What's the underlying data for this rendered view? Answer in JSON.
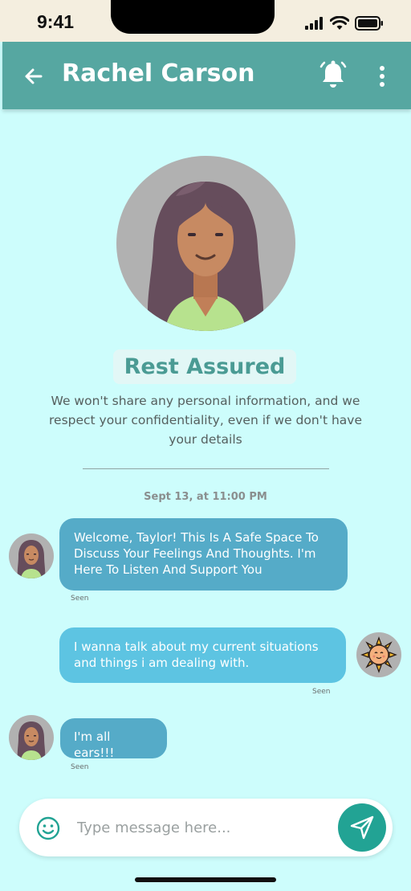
{
  "status_bar": {
    "time": "9:41"
  },
  "header": {
    "title": "Rachel Carson"
  },
  "intro": {
    "title": "Rest Assured",
    "description": "We won't share any personal information, and we respect your confidentiality, even if we don't have your details"
  },
  "chat": {
    "date": "Sept 13, at 11:00 PM",
    "messages": [
      {
        "direction": "incoming",
        "text": "Welcome, Taylor!  This Is A Safe Space To Discuss Your Feelings And Thoughts. I'm Here To Listen And Support You",
        "status": "Seen"
      },
      {
        "direction": "outgoing",
        "text": " I  wanna talk about my current situations and things i am dealing with.",
        "status": "Seen"
      },
      {
        "direction": "incoming",
        "text": "I'm all ears!!!",
        "status": "Seen"
      }
    ]
  },
  "composer": {
    "placeholder": "Type message here..."
  },
  "colors": {
    "background": "#cdfdfc",
    "header": "#56a7a1",
    "incoming_bubble": "#55abc8",
    "outgoing_bubble": "#5dc4e2",
    "send_button": "#22a394"
  },
  "icons": [
    "signal-icon",
    "wifi-icon",
    "battery-icon",
    "back-arrow-icon",
    "bell-icon",
    "more-vertical-icon",
    "emoji-icon",
    "send-icon"
  ]
}
